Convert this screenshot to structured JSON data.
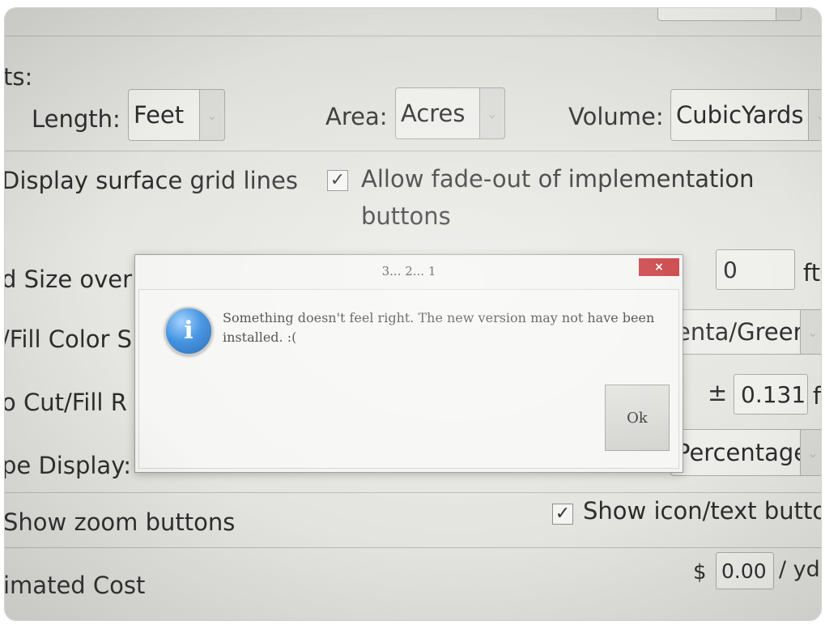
{
  "units": {
    "section_label": "ts:",
    "length_label": "Length:",
    "length_value": "Feet",
    "area_label": "Area:",
    "area_value": "Acres",
    "volume_label": "Volume:",
    "volume_value": "CubicYards"
  },
  "options": {
    "surface_grid_label": "Display surface grid lines",
    "fade_out_label_line1": "Allow fade-out of implementation",
    "fade_out_label_line2": "buttons",
    "fade_out_checked": true
  },
  "settings": {
    "size_label": "d Size over",
    "size_value": "0",
    "size_unit": "ft",
    "fill_color_label": "/Fill Color S",
    "fill_color_value": "enta/Green",
    "cutfill_label": "o Cut/Fill R",
    "cutfill_prefix": "±",
    "cutfill_value": "0.131",
    "cutfill_unit": "f",
    "slope_label": "pe Display:",
    "slope_value": "Percentage",
    "zoom_label": "Show zoom buttons",
    "icon_text_label": "Show icon/text buttor",
    "icon_text_checked": true,
    "cost_label": "imated Cost",
    "cost_prefix": "$",
    "cost_value": "0.00",
    "cost_unit": "/ yd"
  },
  "dialog": {
    "title": "3... 2... 1",
    "close_glyph": "×",
    "icon": "info-icon",
    "message": "Something doesn't feel right. The new version may not have been installed. :(",
    "ok_label": "Ok"
  },
  "icons": {
    "check_glyph": "✓",
    "chevron_glyph": "⌄"
  }
}
